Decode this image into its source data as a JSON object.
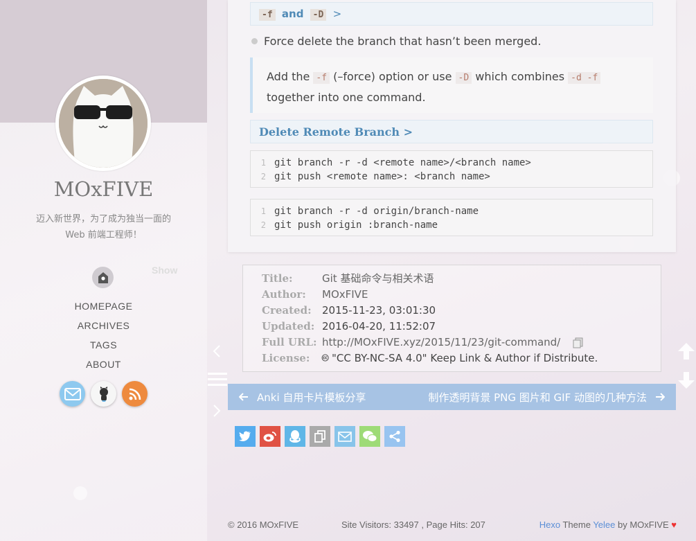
{
  "sidebar": {
    "title": "MOxFIVE",
    "desc_line1": "迈入新世界，为了成为独当一面的",
    "desc_line2": "Web 前端工程师！",
    "show_label": "Show",
    "nav": [
      "HOMEPAGE",
      "ARCHIVES",
      "TAGS",
      "ABOUT"
    ],
    "social": [
      {
        "icon": "mail-icon",
        "color": "#8ec9ef"
      },
      {
        "icon": "github-icon",
        "color": "#f6f6f6"
      },
      {
        "icon": "rss-icon",
        "color": "#ee8a3e"
      }
    ]
  },
  "article": {
    "heading_force": {
      "code1": "-f",
      "word": "and",
      "code2": "-D",
      "arrow": ">"
    },
    "bullet": "Force delete the branch that hasn’t been merged.",
    "quote": {
      "t1": "Add the ",
      "c1": "-f",
      "t2": " (–force) option or use ",
      "c2": "-D",
      "t3": " which combines ",
      "c3": "-d -f",
      "t4": "together into one command."
    },
    "heading_delete": "Delete Remote Branch >",
    "code_block_1": [
      {
        "n": "1",
        "code": "git branch -r -d <remote name>/<branch name>"
      },
      {
        "n": "2",
        "code": "git push <remote name>: <branch name>"
      }
    ],
    "code_block_2": [
      {
        "n": "1",
        "code": "git branch -r -d origin/branch-name"
      },
      {
        "n": "2",
        "code": "git push origin :branch-name"
      }
    ]
  },
  "meta": {
    "title_label": "Title:",
    "title": "Git 基础命令与相关术语",
    "author_label": "Author:",
    "author": "MOxFIVE",
    "created_label": "Created:",
    "created": "2015-11-23, 03:01:30",
    "updated_label": "Updated:",
    "updated": "2016-04-20, 11:52:07",
    "url_label": "Full URL:",
    "url": "http://MOxFIVE.xyz/2015/11/23/git-command/",
    "license_label": "License:",
    "license_icon": "🅭",
    "license": "\"CC BY-NC-SA 4.0\" Keep Link & Author if Distribute."
  },
  "post_nav": {
    "prev": "Anki 自用卡片模板分享",
    "next": "制作透明背景 PNG 图片和 GIF 动图的几种方法"
  },
  "share": [
    {
      "icon": "twitter-icon",
      "color": "#55acee"
    },
    {
      "icon": "weibo-icon",
      "color": "#e05244"
    },
    {
      "icon": "qq-icon",
      "color": "#5fb6e7"
    },
    {
      "icon": "copy-link-icon",
      "color": "#aaaaaa"
    },
    {
      "icon": "email-icon",
      "color": "#88c4ea"
    },
    {
      "icon": "wechat-icon",
      "color": "#9edb77"
    },
    {
      "icon": "share-icon",
      "color": "#98c4f0"
    }
  ],
  "footer": {
    "copyright": "© 2016 MOxFIVE",
    "stats": "Site Visitors: 33497 , Page Hits: 207",
    "hexo": "Hexo",
    "theme": " Theme ",
    "yelee": "Yelee",
    "by": " by MOxFIVE "
  },
  "colors": {
    "accent": "#4f8ab6",
    "nav_bar": "#a7c3e4",
    "link": "#5b8fd6",
    "heart": "#e33"
  }
}
